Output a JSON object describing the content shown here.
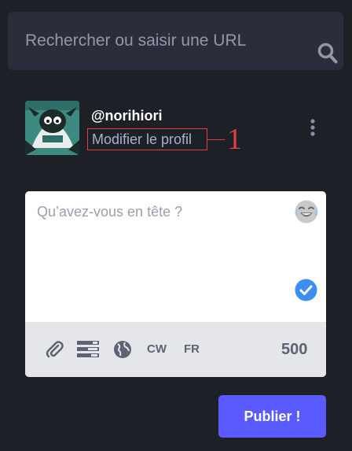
{
  "search": {
    "placeholder": "Rechercher ou saisir une URL",
    "icon": "search-icon"
  },
  "profile": {
    "username": "@norihiori",
    "edit_label": "Modifier le profil",
    "annotation": "1"
  },
  "composer": {
    "placeholder": "Qu’avez-vous en tête ?",
    "cw_label": "CW",
    "language_label": "FR",
    "char_count": "500"
  },
  "publish_label": "Publier !",
  "colors": {
    "background": "#1e2028",
    "accent": "#595aff",
    "annotation": "#e0413f"
  }
}
